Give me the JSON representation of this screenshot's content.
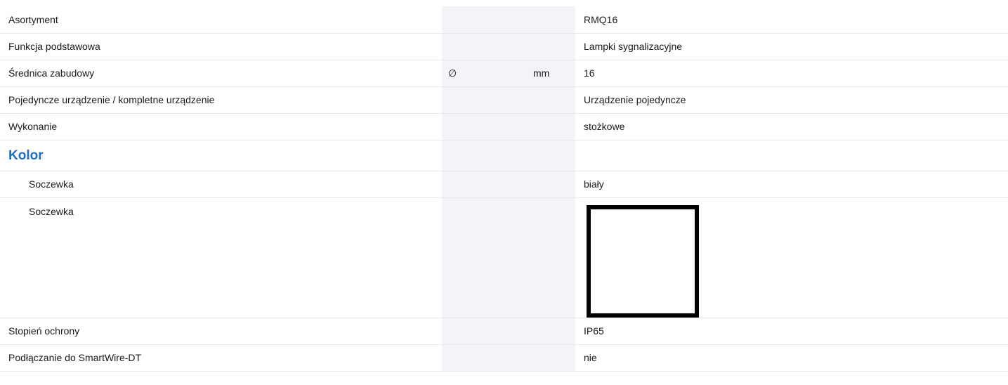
{
  "rows": [
    {
      "label": "Asortyment",
      "symbol": "",
      "unit": "",
      "value": "RMQ16"
    },
    {
      "label": "Funkcja podstawowa",
      "symbol": "",
      "unit": "",
      "value": "Lampki sygnalizacyjne"
    },
    {
      "label": "Średnica zabudowy",
      "symbol": "∅",
      "unit": "mm",
      "value": "16"
    },
    {
      "label": "Pojedyncze urządzenie / kompletne urządzenie",
      "symbol": "",
      "unit": "",
      "value": "Urządzenie pojedyncze"
    },
    {
      "label": "Wykonanie",
      "symbol": "",
      "unit": "",
      "value": "stożkowe"
    }
  ],
  "section_kolor": {
    "title": "Kolor"
  },
  "kolor_rows": [
    {
      "label": "Soczewka",
      "value": "biały"
    },
    {
      "label": "Soczewka",
      "swatch_color": "#ffffff"
    }
  ],
  "tail_rows": [
    {
      "label": "Stopień ochrony",
      "value": "IP65"
    },
    {
      "label": "Podłączanie do SmartWire-DT",
      "value": "nie"
    }
  ],
  "colors": {
    "section_heading": "#1f6fc5",
    "unit_column_bg": "#f2f4f7",
    "row_divider": "#e7e9ee"
  }
}
